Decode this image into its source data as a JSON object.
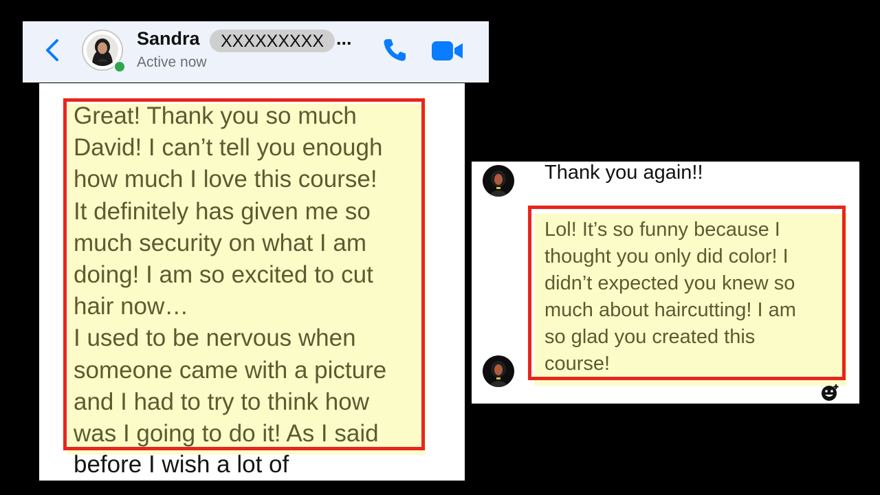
{
  "header": {
    "contact_first_name": "Sandra",
    "contact_last_name_redacted": "XXXXXXXXX",
    "ellipsis": "...",
    "status": "Active now",
    "accent_color": "#0a7cff",
    "online_color": "#2ea84d",
    "back_icon": "chevron-left-icon",
    "call_icon": "phone-icon",
    "video_icon": "video-camera-icon"
  },
  "left_message": {
    "text": "Great! Thank you so much\nDavid! I can’t tell you enough\nhow much I love this course!\nIt definitely has given me so\nmuch security on what I am\ndoing! I am so excited to cut\nhair now…\nI used to be nervous when\nsomeone came with a picture\nand I had to try to think how\nwas I going to do it! As I said",
    "continuation": "before I wish a lot of",
    "highlight_color": "#fcfcc9",
    "box_color": "#e8261c"
  },
  "right_messages": {
    "first": "Thank you again!!",
    "second": "Lol! It’s so funny because I\nthought you only did color! I\ndidn’t expected you knew so\nmuch about haircutting! I am\nso glad you created this\ncourse!",
    "react_icon": "add-reaction-icon"
  }
}
